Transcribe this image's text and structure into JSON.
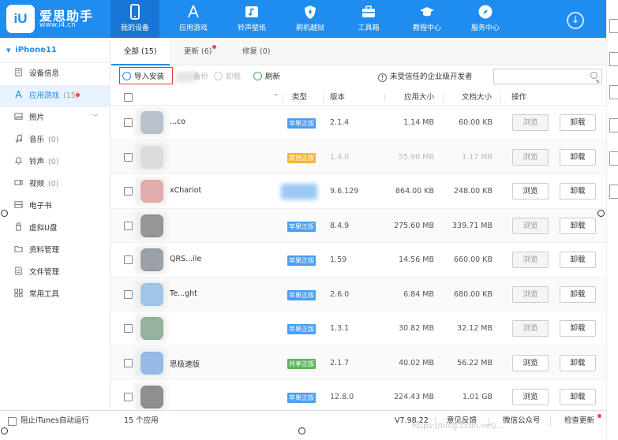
{
  "header": {
    "brand_name": "爱思助手",
    "brand_url": "www.i4.cn",
    "logo_text": "iU",
    "nav": [
      {
        "label": "我的设备",
        "icon": "phone-icon",
        "active": true
      },
      {
        "label": "应用游戏",
        "icon": "appstore-icon"
      },
      {
        "label": "铃声壁纸",
        "icon": "music-icon"
      },
      {
        "label": "刷机越狱",
        "icon": "shield-icon"
      },
      {
        "label": "工具箱",
        "icon": "toolbox-icon"
      },
      {
        "label": "教程中心",
        "icon": "graduation-cap-icon"
      },
      {
        "label": "服务中心",
        "icon": "compass-icon"
      }
    ],
    "download_icon": "↓"
  },
  "sidebar": {
    "device_name": "iPhone11",
    "items": [
      {
        "label": "设备信息",
        "icon": "info-icon",
        "count": ""
      },
      {
        "label": "应用游戏",
        "icon": "appstore-icon",
        "count": "(15)",
        "active": true
      },
      {
        "label": "照片",
        "icon": "photo-icon",
        "count": ""
      },
      {
        "label": "音乐",
        "icon": "music-note-icon",
        "count": "(0)"
      },
      {
        "label": "铃声",
        "icon": "bell-icon",
        "count": "(0)"
      },
      {
        "label": "视频",
        "icon": "video-icon",
        "count": "(0)"
      },
      {
        "label": "电子书",
        "icon": "book-icon",
        "count": ""
      },
      {
        "label": "虚拟U盘",
        "icon": "usb-icon",
        "count": ""
      },
      {
        "label": "资料管理",
        "icon": "folder-icon",
        "count": ""
      },
      {
        "label": "文件管理",
        "icon": "file-icon",
        "count": ""
      },
      {
        "label": "常用工具",
        "icon": "grid-icon",
        "count": ""
      }
    ]
  },
  "tabs": [
    {
      "label": "全部 (15)",
      "active": true
    },
    {
      "label": "更新 (6)"
    },
    {
      "label": "修复 (0)"
    }
  ],
  "toolbar": {
    "import_label": "导入安装",
    "backup_label": "备份",
    "uninstall_label": "卸载",
    "refresh_label": "刷新",
    "untrusted_label": "未受信任的企业级开发者",
    "search_placeholder": ""
  },
  "table": {
    "headers": {
      "type": "类型",
      "version": "版本",
      "app_size": "应用大小",
      "doc_size": "文档大小",
      "action": "操作"
    },
    "browse_label": "浏览",
    "uninstall_label": "卸载",
    "rows": [
      {
        "name": "...co",
        "badge": "苹果正版",
        "badge_type": "genuine",
        "version": "2.1.4",
        "app_size": "1.14 MB",
        "doc_size": "60.00 KB",
        "icon_color": "#7a8da8",
        "faded": false,
        "browse_enabled": false
      },
      {
        "name": "",
        "badge": "其他正版",
        "badge_type": "other",
        "version": "1.4.0",
        "app_size": "55.90 MB",
        "doc_size": "1.17 MB",
        "icon_color": "#d0d0d0",
        "faded": true,
        "browse_enabled": false
      },
      {
        "name": "xChariot",
        "badge": "",
        "badge_type": "genuine",
        "version": "9.6.129",
        "app_size": "864.00 KB",
        "doc_size": "248.00 KB",
        "icon_color": "#e05a5a",
        "faded": false,
        "browse_enabled": true
      },
      {
        "name": "",
        "badge": "苹果正版",
        "badge_type": "genuine",
        "version": "8.4.9",
        "app_size": "275.60 MB",
        "doc_size": "339.71 MB",
        "icon_color": "#222222",
        "faded": false,
        "browse_enabled": false
      },
      {
        "name": "QRS...ile",
        "badge": "苹果正版",
        "badge_type": "genuine",
        "version": "1.59",
        "app_size": "14.56 MB",
        "doc_size": "660.00 KB",
        "icon_color": "#2c3e50",
        "faded": false,
        "browse_enabled": false
      },
      {
        "name": "Te...ght",
        "badge": "苹果正版",
        "badge_type": "genuine",
        "version": "2.6.0",
        "app_size": "6.84 MB",
        "doc_size": "680.00 KB",
        "icon_color": "#3a9be8",
        "faded": false,
        "browse_enabled": false
      },
      {
        "name": "",
        "badge": "苹果正版",
        "badge_type": "genuine",
        "version": "1.3.1",
        "app_size": "30.82 MB",
        "doc_size": "32.12 MB",
        "icon_color": "#1c6b3a",
        "faded": false,
        "browse_enabled": false
      },
      {
        "name": "思极速版",
        "badge": "共享正版",
        "badge_type": "shared",
        "version": "2.1.7",
        "app_size": "40.02 MB",
        "doc_size": "56.22 MB",
        "icon_color": "#1f7ee8",
        "faded": false,
        "browse_enabled": true
      },
      {
        "name": "",
        "badge": "苹果正版",
        "badge_type": "genuine",
        "version": "12.8.0",
        "app_size": "224.43 MB",
        "doc_size": "1.01 GB",
        "icon_color": "#111111",
        "faded": false,
        "browse_enabled": true
      }
    ]
  },
  "footer": {
    "itunes_label": "阻止iTunes自动运行",
    "app_count": "15 个应用",
    "version": "V7.98.22",
    "feedback": "意见反馈",
    "wechat": "微信公众号",
    "check_update": "检查更新"
  },
  "watermark": "https://blog.csdn.net/..."
}
